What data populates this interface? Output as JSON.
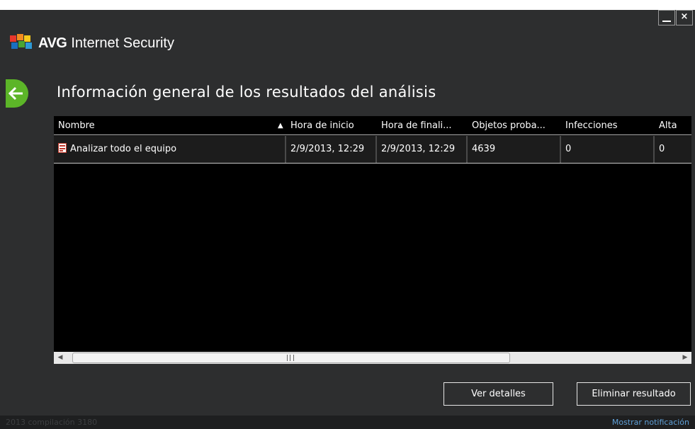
{
  "window": {
    "minimize_label": "—",
    "close_label": "×"
  },
  "app": {
    "brand": "AVG",
    "product": "Internet Security"
  },
  "page": {
    "title": "Información general de los resultados del análisis"
  },
  "table": {
    "columns": [
      "Nombre",
      "Hora de inicio",
      "Hora de finali...",
      "Objetos proba...",
      "Infecciones",
      "Alta"
    ],
    "sort_indicator": "▲",
    "rows": [
      {
        "name": "Analizar todo el equipo",
        "start": "2/9/2013, 12:29",
        "end": "2/9/2013, 12:29",
        "objects": "4639",
        "infections": "0",
        "high": "0"
      }
    ]
  },
  "scrollbar": {
    "left_arrow": "◀",
    "right_arrow": "▶"
  },
  "buttons": {
    "details": "Ver detalles",
    "delete": "Eliminar resultado"
  },
  "footer": {
    "build": "2013  compilación 3180",
    "notification": "Mostrar notificación"
  },
  "colors": {
    "window_bg": "#2d2e2f",
    "table_bg": "#000000",
    "accent_green": "#5cb528",
    "link_blue": "#5fa0d8"
  },
  "icons": [
    "minimize-icon",
    "close-icon",
    "avg-logo-icon",
    "back-arrow-icon",
    "scan-report-icon",
    "sort-ascending-icon"
  ]
}
